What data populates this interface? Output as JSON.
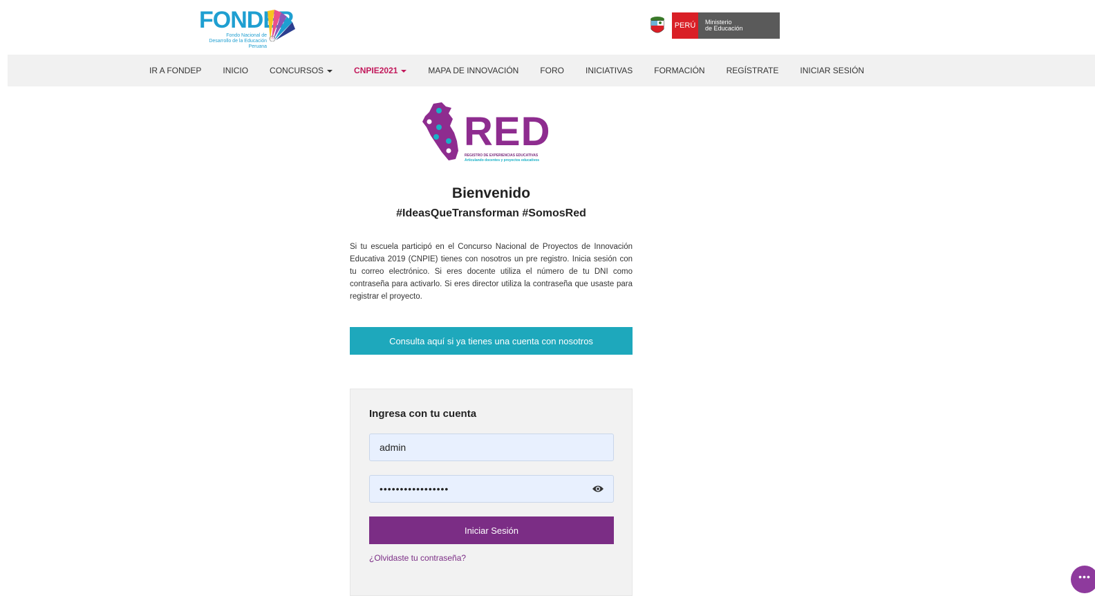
{
  "header": {
    "fondep_logo_text": "FONDEP",
    "fondep_logo_sub": "Fondo Nacional de Desarrollo de la Educación Peruana",
    "peru_label": "PERÚ",
    "ministry_line1": "Ministerio",
    "ministry_line2": "de Educación"
  },
  "nav": {
    "items": [
      {
        "label": "IR A FONDEP"
      },
      {
        "label": "INICIO"
      },
      {
        "label": "CONCURSOS"
      },
      {
        "label": "CNPIE2021"
      },
      {
        "label": "MAPA DE INNOVACIÓN"
      },
      {
        "label": "FORO"
      },
      {
        "label": "INICIATIVAS"
      },
      {
        "label": "FORMACIÓN"
      },
      {
        "label": "REGÍSTRATE"
      },
      {
        "label": "INICIAR SESIÓN"
      }
    ]
  },
  "red_logo": {
    "text": "RED",
    "subtitle": "REGISTRO DE EXPERIENCIAS EDUCATIVAS",
    "tagline": "Articulando docentes y proyectos educativos"
  },
  "main": {
    "title": "Bienvenido",
    "subtitle": "#IdeasQueTransforman #SomosRed",
    "intro": "Si tu escuela participó en el Concurso Nacional de Proyectos de Innovación Educativa 2019 (CNPIE) tienes con nosotros un pre registro. Inicia sesión con tu correo electrónico. Si eres docente utiliza el número de tu DNI como contraseña para activarlo. Si eres director utiliza la contraseña que usaste para registrar el proyecto.",
    "consult_button": "Consulta aquí si ya tienes una cuenta con nosotros"
  },
  "login": {
    "title": "Ingresa con tu cuenta",
    "username_value": "admin",
    "password_value": "•••••••••••••••••",
    "submit_label": "Iniciar Sesión",
    "forgot_link": "¿Olvidaste tu contraseña?"
  },
  "colors": {
    "teal_button": "#1ea8bc",
    "purple_button": "#7b2d85",
    "active_nav": "#c2185b",
    "red_brand": "#8e2c8f"
  }
}
